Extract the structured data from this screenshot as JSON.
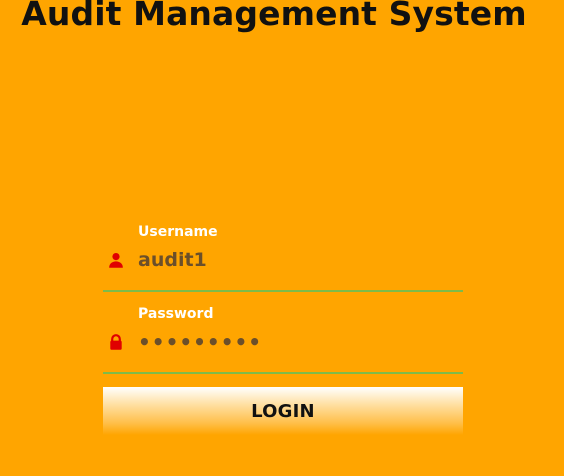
{
  "app": {
    "title": "Audit Management System"
  },
  "login_form": {
    "username": {
      "label": "Username",
      "value": "audit1",
      "icon": "user-icon"
    },
    "password": {
      "label": "Password",
      "value": "•••••••••",
      "icon": "lock-icon"
    },
    "submit_label": "LOGIN"
  },
  "colors": {
    "background": "#FFA500",
    "title_text": "#111111",
    "label_text": "#FFFFFF",
    "icon_red": "#E00000",
    "underline_green": "#7DBB4A",
    "input_text": "#6B4F2A"
  }
}
